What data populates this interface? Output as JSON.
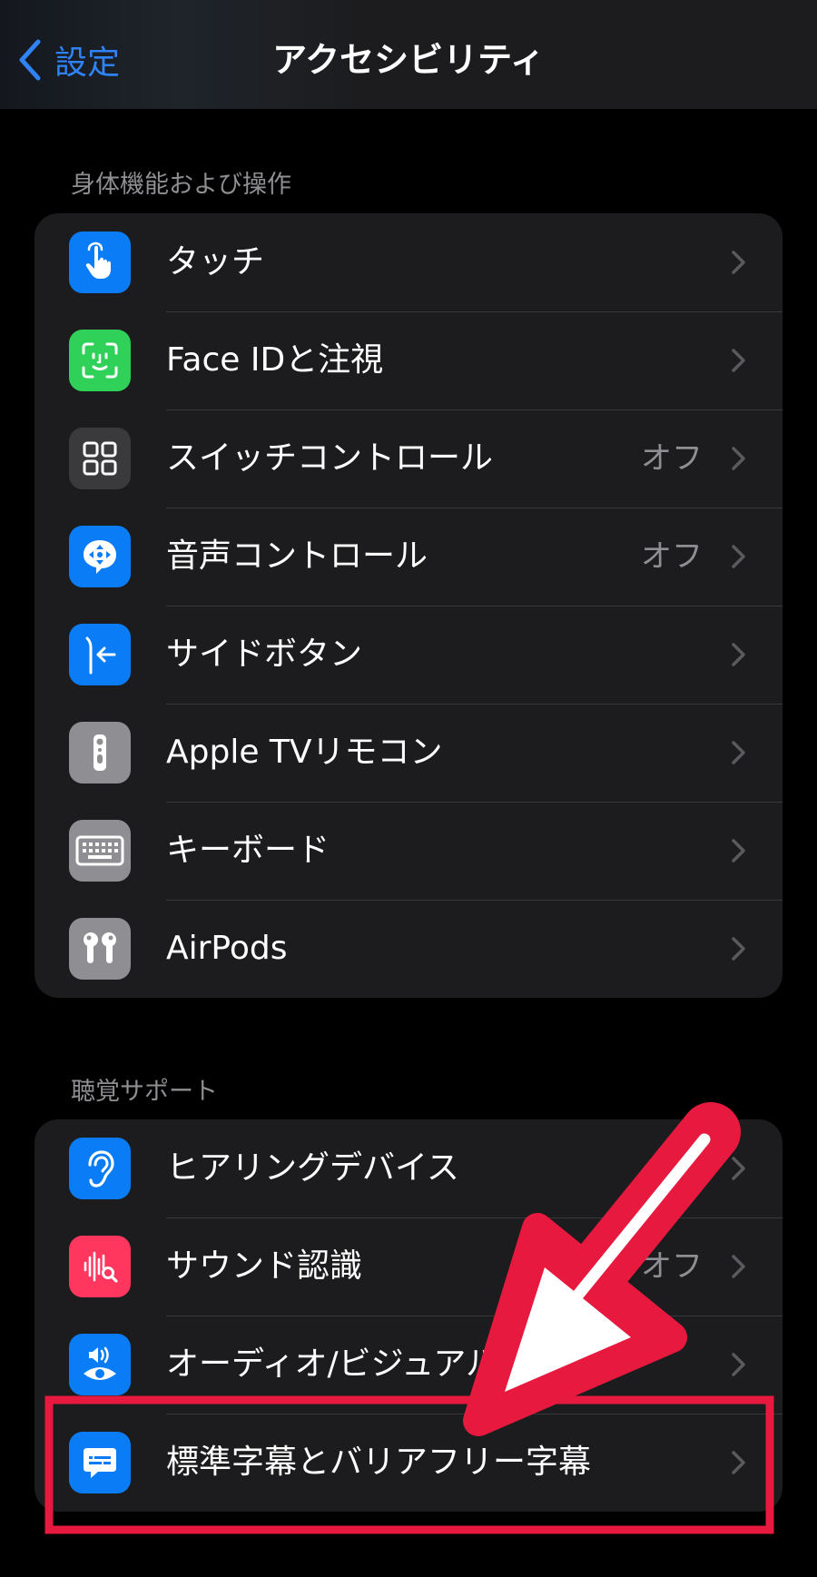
{
  "nav": {
    "back_label": "設定",
    "title": "アクセシビリティ"
  },
  "sections": [
    {
      "header": "身体機能および操作",
      "items": [
        {
          "label": "タッチ",
          "value": "",
          "icon": "hand-pointer-icon",
          "color": "#0a7cf5"
        },
        {
          "label": "Face IDと注視",
          "value": "",
          "icon": "face-id-icon",
          "color": "#30d158"
        },
        {
          "label": "スイッチコントロール",
          "value": "オフ",
          "icon": "switch-grid-icon",
          "color": "#3a3a3c"
        },
        {
          "label": "音声コントロール",
          "value": "オフ",
          "icon": "voice-control-icon",
          "color": "#0a7cf5"
        },
        {
          "label": "サイドボタン",
          "value": "",
          "icon": "side-button-icon",
          "color": "#0a7cf5"
        },
        {
          "label": "Apple TVリモコン",
          "value": "",
          "icon": "tv-remote-icon",
          "color": "#8e8e93"
        },
        {
          "label": "キーボード",
          "value": "",
          "icon": "keyboard-icon",
          "color": "#8e8e93"
        },
        {
          "label": "AirPods",
          "value": "",
          "icon": "airpods-icon",
          "color": "#8e8e93"
        }
      ]
    },
    {
      "header": "聴覚サポート",
      "items": [
        {
          "label": "ヒアリングデバイス",
          "value": "",
          "icon": "ear-icon",
          "color": "#0a7cf5"
        },
        {
          "label": "サウンド認識",
          "value": "オフ",
          "icon": "sound-recognition-icon",
          "color": "#ff375f"
        },
        {
          "label": "オーディオ/ビジュアル",
          "value": "",
          "icon": "audio-visual-icon",
          "color": "#0a7cf5"
        },
        {
          "label": "標準字幕とバリアフリー字幕",
          "value": "",
          "icon": "subtitles-icon",
          "color": "#0a7cf5"
        }
      ]
    }
  ],
  "annotation": {
    "color": "#e8193f"
  }
}
